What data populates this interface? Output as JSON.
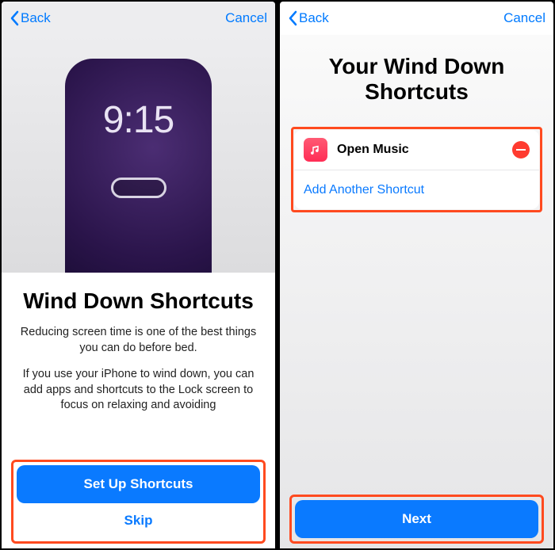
{
  "nav": {
    "back": "Back",
    "cancel": "Cancel"
  },
  "left": {
    "clock": "9:15",
    "title": "Wind Down Shortcuts",
    "para1": "Reducing screen time is one of the best things you can do before bed.",
    "para2": "If you use your iPhone to wind down, you can add apps and shortcuts to the Lock screen to focus on relaxing and avoiding",
    "primary": "Set Up Shortcuts",
    "secondary": "Skip"
  },
  "right": {
    "title": "Your Wind Down Shortcuts",
    "shortcut_label": "Open Music",
    "add_another": "Add Another Shortcut",
    "primary": "Next"
  }
}
